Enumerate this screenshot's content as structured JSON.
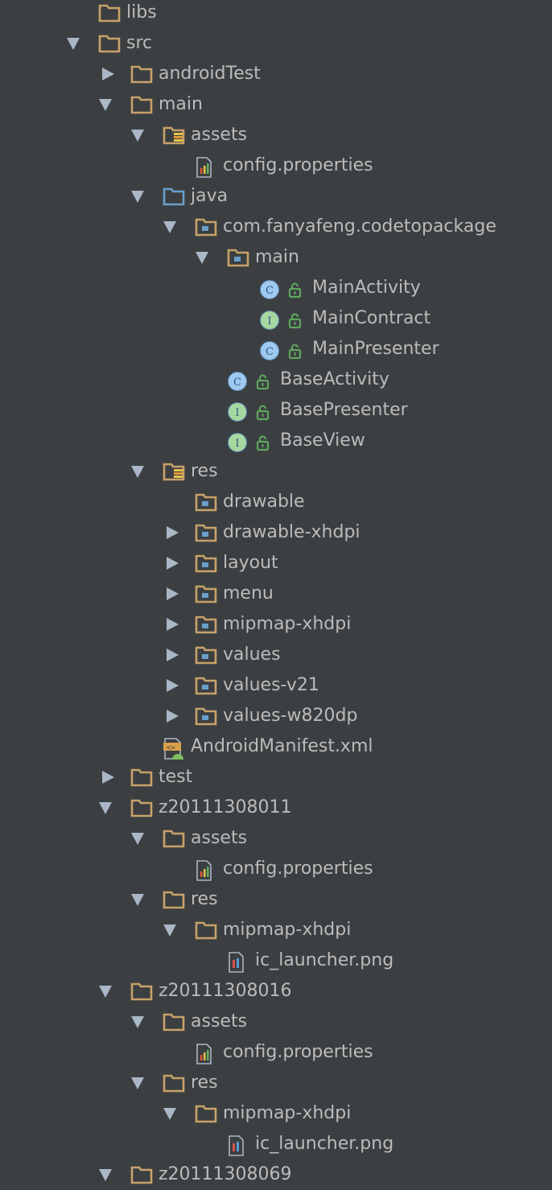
{
  "colors": {
    "background": "#3c3f41",
    "text": "#bbbbbb",
    "folder": "#c8a26a",
    "source_folder": "#6a9fc9",
    "class_icon": "#9fc9ee",
    "interface_icon": "#a6d8a0",
    "lock": "#5fa65f"
  },
  "tree": [
    {
      "label": "libs",
      "level": 0,
      "arrow": "none",
      "icon": "folder-icon"
    },
    {
      "label": "src",
      "level": 0,
      "arrow": "down",
      "icon": "folder-icon"
    },
    {
      "label": "androidTest",
      "level": 1,
      "arrow": "right",
      "icon": "folder-icon"
    },
    {
      "label": "main",
      "level": 1,
      "arrow": "down",
      "icon": "folder-icon"
    },
    {
      "label": "assets",
      "level": 2,
      "arrow": "down",
      "icon": "resource-folder-icon"
    },
    {
      "label": "config.properties",
      "level": 3,
      "arrow": "none",
      "icon": "properties-file-icon"
    },
    {
      "label": "java",
      "level": 2,
      "arrow": "down",
      "icon": "source-folder-icon"
    },
    {
      "label": "com.fanyafeng.codetopackage",
      "level": 3,
      "arrow": "down",
      "icon": "package-icon"
    },
    {
      "label": "main",
      "level": 4,
      "arrow": "down",
      "icon": "package-icon"
    },
    {
      "label": "MainActivity",
      "level": 5,
      "arrow": "none",
      "icon": "class-icon"
    },
    {
      "label": "MainContract",
      "level": 5,
      "arrow": "none",
      "icon": "interface-icon"
    },
    {
      "label": "MainPresenter",
      "level": 5,
      "arrow": "none",
      "icon": "class-icon"
    },
    {
      "label": "BaseActivity",
      "level": 4,
      "arrow": "none",
      "icon": "class-icon"
    },
    {
      "label": "BasePresenter",
      "level": 4,
      "arrow": "none",
      "icon": "interface-icon"
    },
    {
      "label": "BaseView",
      "level": 4,
      "arrow": "none",
      "icon": "interface-icon"
    },
    {
      "label": "res",
      "level": 2,
      "arrow": "down",
      "icon": "resource-folder-icon"
    },
    {
      "label": "drawable",
      "level": 3,
      "arrow": "none",
      "icon": "package-icon"
    },
    {
      "label": "drawable-xhdpi",
      "level": 3,
      "arrow": "right",
      "icon": "package-icon"
    },
    {
      "label": "layout",
      "level": 3,
      "arrow": "right",
      "icon": "package-icon"
    },
    {
      "label": "menu",
      "level": 3,
      "arrow": "right",
      "icon": "package-icon"
    },
    {
      "label": "mipmap-xhdpi",
      "level": 3,
      "arrow": "right",
      "icon": "package-icon"
    },
    {
      "label": "values",
      "level": 3,
      "arrow": "right",
      "icon": "package-icon"
    },
    {
      "label": "values-v21",
      "level": 3,
      "arrow": "right",
      "icon": "package-icon"
    },
    {
      "label": "values-w820dp",
      "level": 3,
      "arrow": "right",
      "icon": "package-icon"
    },
    {
      "label": "AndroidManifest.xml",
      "level": 2,
      "arrow": "none",
      "icon": "manifest-file-icon"
    },
    {
      "label": "test",
      "level": 1,
      "arrow": "right",
      "icon": "folder-icon"
    },
    {
      "label": "z20111308011",
      "level": 1,
      "arrow": "down",
      "icon": "folder-icon"
    },
    {
      "label": "assets",
      "level": 2,
      "arrow": "down",
      "icon": "folder-icon"
    },
    {
      "label": "config.properties",
      "level": 3,
      "arrow": "none",
      "icon": "properties-file-icon"
    },
    {
      "label": "res",
      "level": 2,
      "arrow": "down",
      "icon": "folder-icon"
    },
    {
      "label": "mipmap-xhdpi",
      "level": 3,
      "arrow": "down",
      "icon": "folder-icon"
    },
    {
      "label": "ic_launcher.png",
      "level": 4,
      "arrow": "none",
      "icon": "image-file-icon"
    },
    {
      "label": "z20111308016",
      "level": 1,
      "arrow": "down",
      "icon": "folder-icon"
    },
    {
      "label": "assets",
      "level": 2,
      "arrow": "down",
      "icon": "folder-icon"
    },
    {
      "label": "config.properties",
      "level": 3,
      "arrow": "none",
      "icon": "properties-file-icon"
    },
    {
      "label": "res",
      "level": 2,
      "arrow": "down",
      "icon": "folder-icon"
    },
    {
      "label": "mipmap-xhdpi",
      "level": 3,
      "arrow": "down",
      "icon": "folder-icon"
    },
    {
      "label": "ic_launcher.png",
      "level": 4,
      "arrow": "none",
      "icon": "image-file-icon"
    },
    {
      "label": "z20111308069",
      "level": 1,
      "arrow": "down",
      "icon": "folder-icon"
    }
  ]
}
